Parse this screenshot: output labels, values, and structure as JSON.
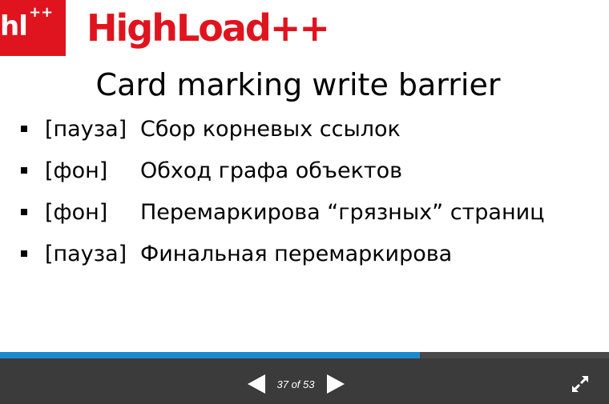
{
  "logo": {
    "badge_text": "hl",
    "badge_plus": "++",
    "brand_text": "HighLoad++",
    "brand_color": "#e0141e"
  },
  "slide": {
    "title": "Card marking write barrier",
    "bullets": [
      {
        "tag": "[пауза]",
        "text": "Сбор корневых ссылок"
      },
      {
        "tag": "[фон]",
        "text": "Обход графа объектов"
      },
      {
        "tag": "[фон]",
        "text": "Перемаркирова “грязных” страниц"
      },
      {
        "tag": "[пауза]",
        "text": "Финальная перемаркирова"
      }
    ]
  },
  "player": {
    "current_page": 37,
    "total_pages": 53,
    "page_indicator": "37 of 53",
    "progress_fraction": 0.69,
    "accent_color": "#1a8ad0",
    "icons": {
      "prev": "triangle-left-icon",
      "next": "triangle-right-icon",
      "fullscreen": "expand-arrows-icon"
    }
  }
}
